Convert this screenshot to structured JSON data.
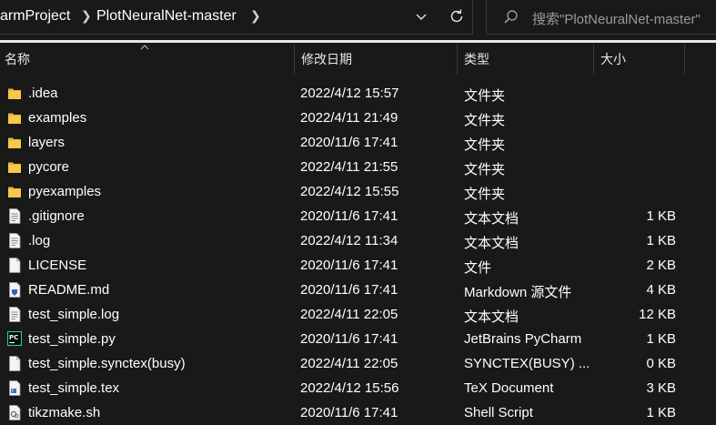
{
  "breadcrumb": {
    "items": [
      "armProject",
      "PlotNeuralNet-master"
    ]
  },
  "search": {
    "placeholder": "搜索\"PlotNeuralNet-master\""
  },
  "columns": {
    "name": "名称",
    "date": "修改日期",
    "type": "类型",
    "size": "大小"
  },
  "files": [
    {
      "name": ".idea",
      "date": "2022/4/12 15:57",
      "type": "文件夹",
      "size": "",
      "icon": "folder-icon"
    },
    {
      "name": "examples",
      "date": "2022/4/11 21:49",
      "type": "文件夹",
      "size": "",
      "icon": "folder-icon"
    },
    {
      "name": "layers",
      "date": "2020/11/6 17:41",
      "type": "文件夹",
      "size": "",
      "icon": "folder-icon"
    },
    {
      "name": "pycore",
      "date": "2022/4/11 21:55",
      "type": "文件夹",
      "size": "",
      "icon": "folder-icon"
    },
    {
      "name": "pyexamples",
      "date": "2022/4/12 15:55",
      "type": "文件夹",
      "size": "",
      "icon": "folder-icon"
    },
    {
      "name": ".gitignore",
      "date": "2020/11/6 17:41",
      "type": "文本文档",
      "size": "1 KB",
      "icon": "text-file-icon"
    },
    {
      "name": ".log",
      "date": "2022/4/12 11:34",
      "type": "文本文档",
      "size": "1 KB",
      "icon": "text-file-icon"
    },
    {
      "name": "LICENSE",
      "date": "2020/11/6 17:41",
      "type": "文件",
      "size": "2 KB",
      "icon": "blank-file-icon"
    },
    {
      "name": "README.md",
      "date": "2020/11/6 17:41",
      "type": "Markdown 源文件",
      "size": "4 KB",
      "icon": "markdown-file-icon"
    },
    {
      "name": "test_simple.log",
      "date": "2022/4/11 22:05",
      "type": "文本文档",
      "size": "12 KB",
      "icon": "text-file-icon"
    },
    {
      "name": "test_simple.py",
      "date": "2020/11/6 17:41",
      "type": "JetBrains PyCharm",
      "size": "1 KB",
      "icon": "pycharm-file-icon"
    },
    {
      "name": "test_simple.synctex(busy)",
      "date": "2022/4/11 22:05",
      "type": "SYNCTEX(BUSY) ...",
      "size": "0 KB",
      "icon": "blank-file-icon"
    },
    {
      "name": "test_simple.tex",
      "date": "2022/4/12 15:56",
      "type": "TeX Document",
      "size": "3 KB",
      "icon": "tex-file-icon"
    },
    {
      "name": "tikzmake.sh",
      "date": "2020/11/6 17:41",
      "type": "Shell Script",
      "size": "1 KB",
      "icon": "shell-script-icon"
    }
  ]
}
